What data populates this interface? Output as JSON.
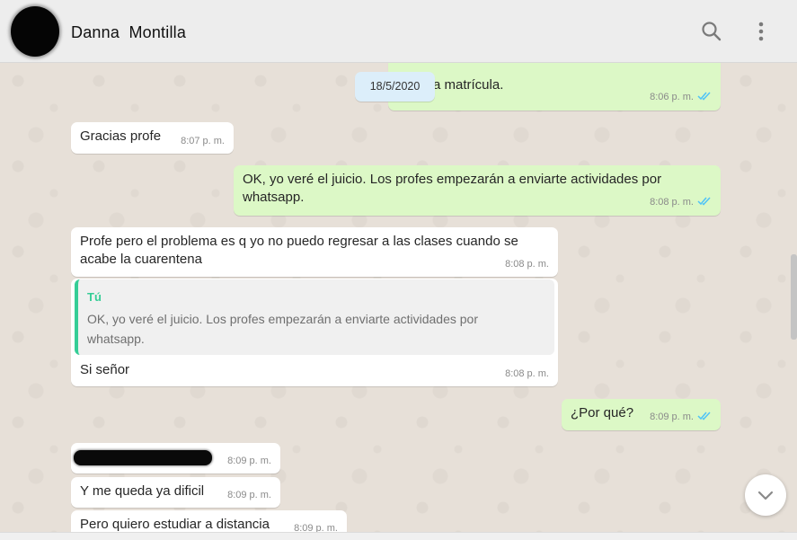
{
  "header": {
    "contact_name": "Danna  Montilla",
    "icons": [
      "search-icon",
      "menu-icon"
    ]
  },
  "date_separator": "18/5/2020",
  "messages": [
    {
      "direction": "out",
      "text": "a matrícula.",
      "time": "8:06 p. m.",
      "status": "read"
    },
    {
      "direction": "in",
      "text": "Gracias profe",
      "time": "8:07 p. m."
    },
    {
      "direction": "out",
      "text": "OK, yo veré el juicio. Los profes empezarán a enviarte actividades por whatsapp.",
      "time": "8:08 p. m.",
      "status": "read"
    },
    {
      "direction": "in",
      "text": "Profe pero el problema es q yo no puedo regresar a las clases cuando se acabe la cuarentena",
      "time": "8:08 p. m."
    },
    {
      "direction": "in",
      "quote_author": "Tú",
      "quote_text": "OK, yo veré el juicio. Los profes empezarán a enviarte actividades por whatsapp.",
      "text": "Si señor",
      "time": "8:08 p. m."
    },
    {
      "direction": "out",
      "text": "¿Por qué?",
      "time": "8:09 p. m.",
      "status": "read"
    },
    {
      "direction": "in",
      "text": "",
      "redacted": true,
      "time": "8:09 p. m."
    },
    {
      "direction": "in",
      "text": "Y me queda ya dificil",
      "time": "8:09 p. m."
    },
    {
      "direction": "in",
      "text": "Pero quiero estudiar a distancia",
      "time": "8:09 p. m."
    }
  ],
  "colors": {
    "incoming_bubble": "#ffffff",
    "outgoing_bubble": "#dcf8c6",
    "read_ticks": "#4fc3f7",
    "quote_accent": "#35cd96"
  }
}
